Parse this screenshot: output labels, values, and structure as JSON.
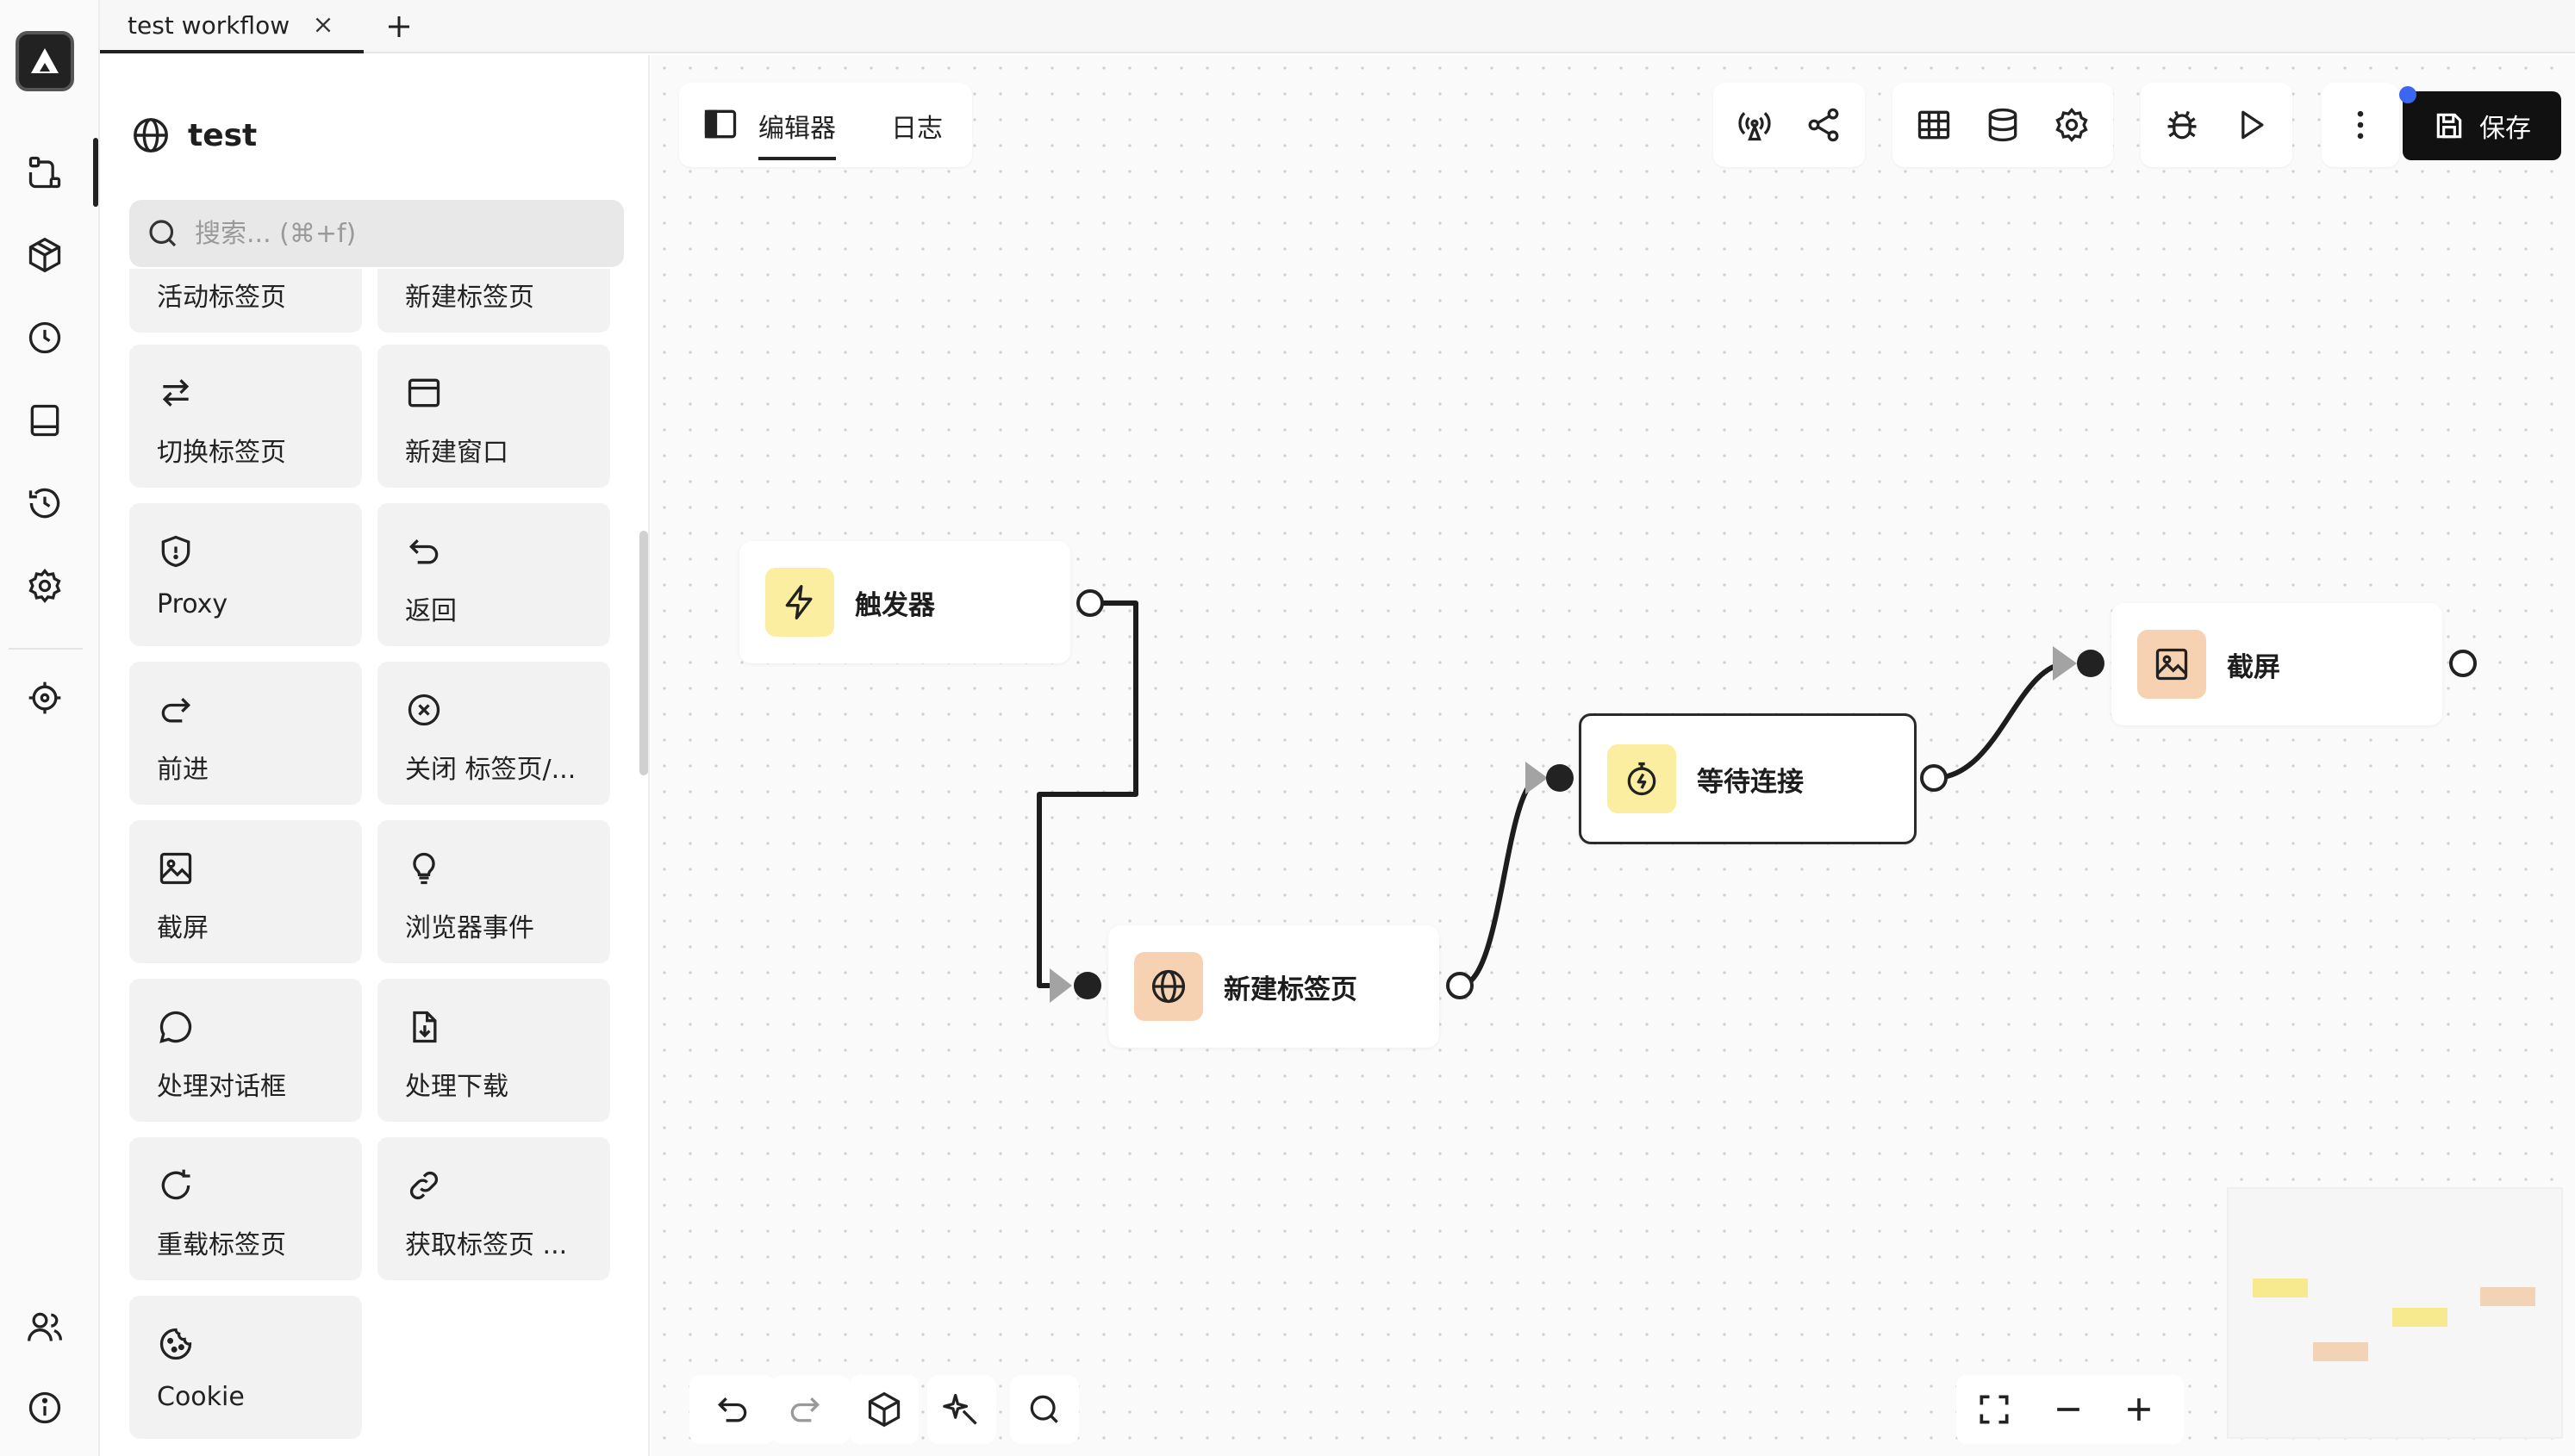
{
  "colors": {
    "accent": "#111111",
    "trigger_yellow": "#fbeea0",
    "orange_node": "#f6d2b3",
    "notification_dot": "#3a66f0"
  },
  "rail": {
    "items": [
      {
        "icon": "workflow-icon"
      },
      {
        "icon": "cube-icon"
      },
      {
        "icon": "clock-icon"
      },
      {
        "icon": "panel-bottom-icon"
      },
      {
        "icon": "history-icon"
      },
      {
        "icon": "gear-icon"
      },
      {
        "icon": "target-icon"
      }
    ],
    "bottom": [
      {
        "icon": "users-icon"
      },
      {
        "icon": "info-icon"
      }
    ]
  },
  "tabs": [
    {
      "label": "test workflow"
    }
  ],
  "panel": {
    "title": "test",
    "search_placeholder": "搜索... (⌘+f)",
    "cards": [
      {
        "label": "活动标签页",
        "icon": "none"
      },
      {
        "label": "新建标签页",
        "icon": "none"
      },
      {
        "label": "切换标签页",
        "icon": "switch-arrows-icon"
      },
      {
        "label": "新建窗口",
        "icon": "window-icon"
      },
      {
        "label": "Proxy",
        "icon": "shield-icon"
      },
      {
        "label": "返回",
        "icon": "undo-icon"
      },
      {
        "label": "前进",
        "icon": "redo-icon"
      },
      {
        "label": "关闭 标签页/...",
        "icon": "close-circle-icon"
      },
      {
        "label": "截屏",
        "icon": "image-icon"
      },
      {
        "label": "浏览器事件",
        "icon": "lightbulb-icon"
      },
      {
        "label": "处理对话框",
        "icon": "chat-bubble-icon"
      },
      {
        "label": "处理下载",
        "icon": "file-download-icon"
      },
      {
        "label": "重载标签页",
        "icon": "reload-icon"
      },
      {
        "label": "获取标签页 ...",
        "icon": "link-icon"
      },
      {
        "label": "Cookie",
        "icon": "cookie-icon"
      }
    ]
  },
  "toolbar": {
    "view_tabs": [
      {
        "label": "编辑器"
      },
      {
        "label": "日志"
      }
    ],
    "save_label": "保存"
  },
  "nodes": [
    {
      "label": "触发器",
      "icon": "lightning-icon"
    },
    {
      "label": "新建标签页",
      "icon": "globe-icon"
    },
    {
      "label": "等待连接",
      "icon": "timer-icon"
    },
    {
      "label": "截屏",
      "icon": "image-icon"
    }
  ]
}
